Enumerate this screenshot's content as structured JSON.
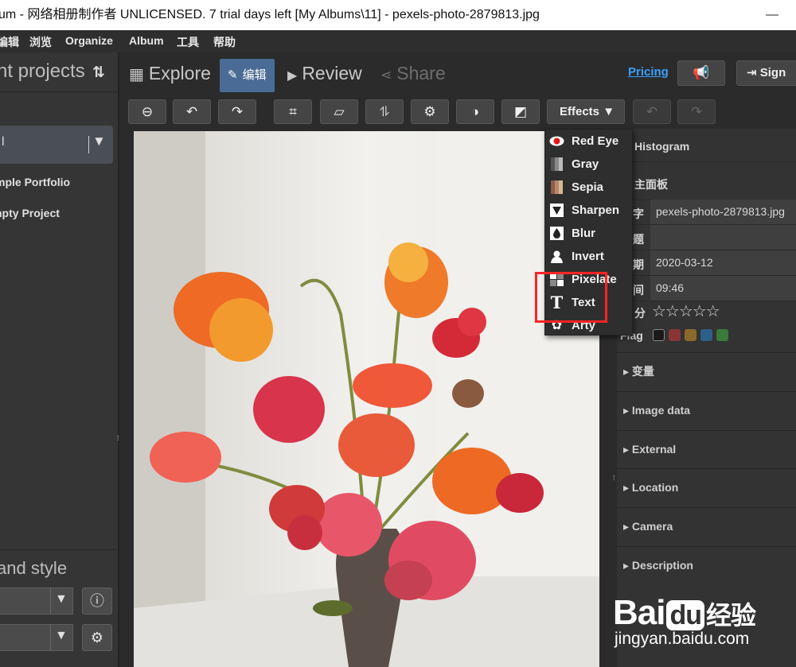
{
  "window": {
    "title": "um - 网络相册制作者 UNLICENSED. 7 trial days left [My Albums\\11] - pexels-photo-2879813.jpg",
    "minimize_glyph": "—"
  },
  "menubar": {
    "items": [
      "编辑",
      "浏览",
      "Organize",
      "Album",
      "工具",
      "帮助"
    ]
  },
  "left_panel": {
    "title": "nt projects",
    "sort_icon": "sort-arrows-icon",
    "selected_project": "l",
    "projects": [
      "mple Portfolio",
      "npty Project"
    ],
    "style_title": "and style"
  },
  "nav": {
    "tabs": [
      {
        "label": "Explore",
        "icon": "grid-icon"
      },
      {
        "label": "编辑",
        "icon": "pencil-icon"
      },
      {
        "label": "Review",
        "icon": "play-icon"
      },
      {
        "label": "Share",
        "icon": "share-icon"
      }
    ],
    "active_tab": "编辑",
    "pricing": "Pricing",
    "sign_in": "Sign"
  },
  "toolbar": {
    "tools": [
      "zoom-out-icon",
      "rotate-left-icon",
      "rotate-right-icon",
      "crop-icon",
      "straighten-icon",
      "flip-icon",
      "settings-icon",
      "contrast-icon",
      "exposure-icon"
    ],
    "effects_label": "Effects",
    "undo": "undo-icon",
    "redo": "redo-icon"
  },
  "effects_menu": {
    "items": [
      {
        "label": "Red Eye",
        "icon": "red-eye-icon"
      },
      {
        "label": "Gray",
        "icon": "gray-icon"
      },
      {
        "label": "Sepia",
        "icon": "sepia-icon"
      },
      {
        "label": "Sharpen",
        "icon": "sharpen-icon"
      },
      {
        "label": "Blur",
        "icon": "blur-drop-icon"
      },
      {
        "label": "Invert",
        "icon": "invert-icon"
      },
      {
        "label": "Pixelate",
        "icon": "pixelate-icon"
      },
      {
        "label": "Text",
        "icon": "text-icon"
      },
      {
        "label": "Arty",
        "icon": "arty-icon"
      }
    ],
    "highlighted": "Text"
  },
  "right_panel": {
    "histogram": "Histogram",
    "main_panel": "主面板",
    "fields": [
      {
        "key": "字",
        "value": "pexels-photo-2879813.jpg"
      },
      {
        "key": "题",
        "value": ""
      },
      {
        "key": "期",
        "value": "2020-03-12"
      },
      {
        "key": "间",
        "value": "09:46"
      }
    ],
    "rating_key": "分",
    "rating_stars": "☆☆☆☆☆",
    "flag_key": "Flag",
    "flag_colors": [
      "#1a1a1a",
      "#8a3535",
      "#8a6a2a",
      "#2e5f8a",
      "#3a7a3a"
    ],
    "sections": [
      "变量",
      "Image data",
      "External",
      "Location",
      "Camera",
      "Description"
    ]
  },
  "watermark": {
    "brand": "Bai",
    "brand_mid": "du",
    "brand_cn": "经验",
    "url": "jingyan.baidu.com"
  }
}
